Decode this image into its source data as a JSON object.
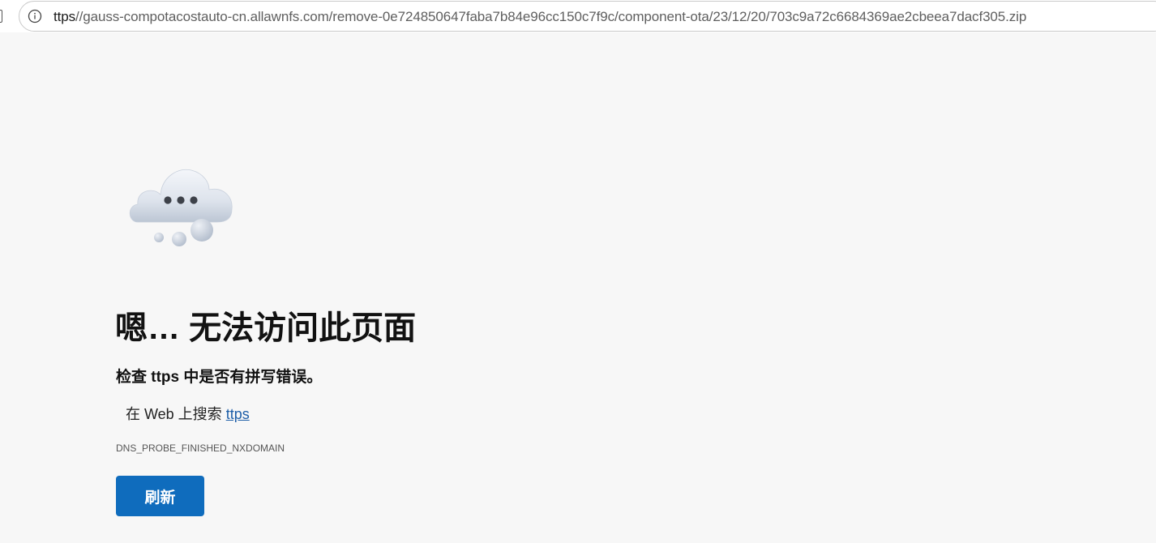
{
  "address_bar": {
    "url_scheme_part": "ttps",
    "url_rest": "//gauss-compotacostauto-cn.allawnfs.com/remove-0e724850647faba7b84e96cc150c7f9c/component-ota/23/12/20/703c9a72c6684369ae2cbeea7dacf305.zip",
    "info_icon": "info-circle-icon"
  },
  "error_page": {
    "illustration": "cloud-icon",
    "title": "嗯… 无法访问此页面",
    "subtitle": "检查 ttps 中是否有拼写错误。",
    "search_prefix": "在 Web 上搜索 ",
    "search_link": "ttps",
    "error_code": "DNS_PROBE_FINISHED_NXDOMAIN",
    "refresh_label": "刷新"
  },
  "colors": {
    "background": "#f7f7f7",
    "button": "#0f6cbd",
    "link": "#1d5ea8"
  }
}
